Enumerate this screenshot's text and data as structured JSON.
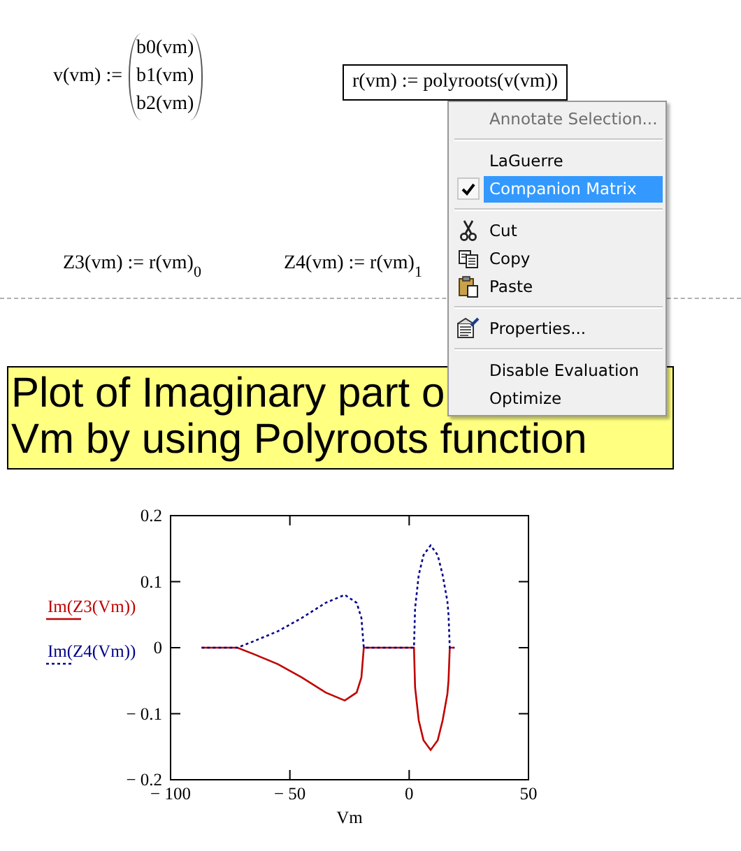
{
  "definitions": [
    {
      "kind": "vector",
      "lhs": "v(vm) :=",
      "elements": [
        "b0(vm)",
        "b1(vm)",
        "b2(vm)"
      ]
    },
    {
      "kind": "expression",
      "text": "r(vm) := polyroots(v(vm))",
      "selected": true
    },
    {
      "kind": "expression",
      "text": "Z3(vm) := r(vm)$_{0}$",
      "selected": false
    },
    {
      "kind": "expression",
      "text": "Z4(vm) := r(vm)$_{1}$",
      "selected": false
    }
  ],
  "text_region": {
    "lines": [
      "Plot of Imaginary part o",
      "Vm by using Polyroots function"
    ]
  },
  "plot": {
    "chart_data": {
      "type": "line",
      "xlabel": "Vm",
      "x": [
        -87,
        -80,
        -72,
        -65,
        -55,
        -45,
        -35,
        -27,
        -22,
        -20,
        -19,
        -15,
        -10,
        -5,
        0,
        2,
        2.5,
        4,
        6,
        9,
        12,
        14,
        16,
        16.5,
        17,
        19
      ],
      "series": [
        {
          "name": "Im(Z3(Vm))",
          "color": "#c00000",
          "line_style": "solid",
          "values": [
            0,
            0,
            0,
            -0.01,
            -0.025,
            -0.045,
            -0.068,
            -0.08,
            -0.068,
            -0.045,
            0,
            0,
            0,
            0,
            0,
            0,
            -0.06,
            -0.11,
            -0.14,
            -0.155,
            -0.14,
            -0.11,
            -0.07,
            -0.05,
            0,
            0
          ]
        },
        {
          "name": "Im(Z4(Vm))",
          "color": "#00008b",
          "line_style": "dotted",
          "values": [
            0,
            0,
            0,
            0.01,
            0.025,
            0.045,
            0.068,
            0.08,
            0.068,
            0.045,
            0,
            0,
            0,
            0,
            0,
            0,
            0.06,
            0.11,
            0.14,
            0.155,
            0.14,
            0.11,
            0.07,
            0.05,
            0,
            0
          ]
        }
      ],
      "xlim": [
        -100,
        50
      ],
      "ylim": [
        -0.2,
        0.2
      ],
      "xticks": [
        {
          "value": -100,
          "label": "− 100"
        },
        {
          "value": -50,
          "label": "− 50"
        },
        0,
        50
      ],
      "yticks": [
        {
          "value": -0.2,
          "label": "− 0.2"
        },
        {
          "value": -0.1,
          "label": "− 0.1"
        },
        0,
        0.1,
        0.2
      ]
    }
  },
  "context_menu": {
    "items": [
      {
        "kind": "item",
        "label": "Annotate Selection...",
        "disabled": true,
        "checked": false,
        "selected": false
      },
      {
        "kind": "separator"
      },
      {
        "kind": "item",
        "label": "LaGuerre",
        "disabled": false,
        "checked": false,
        "selected": false
      },
      {
        "kind": "item",
        "label": "Companion Matrix",
        "disabled": false,
        "checked": true,
        "selected": true
      },
      {
        "kind": "separator"
      },
      {
        "kind": "item",
        "label": "Cut",
        "disabled": false,
        "checked": false,
        "selected": false
      },
      {
        "kind": "item",
        "label": "Copy",
        "disabled": false,
        "checked": false,
        "selected": false
      },
      {
        "kind": "item",
        "label": "Paste",
        "disabled": false,
        "checked": false,
        "selected": false
      },
      {
        "kind": "separator"
      },
      {
        "kind": "item",
        "label": "Properties...",
        "disabled": false,
        "checked": false,
        "selected": false
      },
      {
        "kind": "separator"
      },
      {
        "kind": "item",
        "label": "Disable Evaluation",
        "disabled": false,
        "checked": false,
        "selected": false
      },
      {
        "kind": "item",
        "label": "Optimize",
        "disabled": false,
        "checked": false,
        "selected": false
      }
    ]
  }
}
